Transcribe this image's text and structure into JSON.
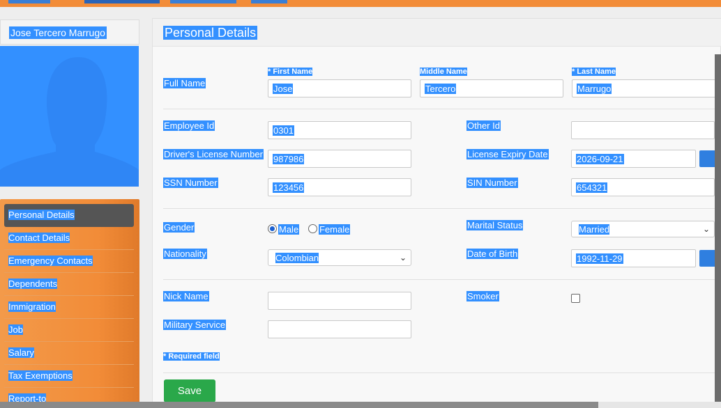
{
  "colors": {
    "accent": "#f28c38",
    "selection": "#3390ff",
    "save": "#2aa84a",
    "active_nav": "#555555"
  },
  "profile": {
    "name": "Jose Tercero Marrugo",
    "avatar_icon": "person-silhouette-icon"
  },
  "sidebar": {
    "items": [
      {
        "label": "Personal Details",
        "active": true
      },
      {
        "label": "Contact Details"
      },
      {
        "label": "Emergency Contacts"
      },
      {
        "label": "Dependents"
      },
      {
        "label": "Immigration"
      },
      {
        "label": "Job"
      },
      {
        "label": "Salary"
      },
      {
        "label": "Tax Exemptions"
      },
      {
        "label": "Report-to"
      }
    ]
  },
  "form": {
    "title": "Personal Details",
    "full_name": {
      "label": "Full Name",
      "first_label": "* First Name",
      "first_value": "Jose",
      "middle_label": "Middle Name",
      "middle_value": "Tercero",
      "last_label": "* Last Name",
      "last_value": "Marrugo"
    },
    "employee_id": {
      "label": "Employee Id",
      "value": "0301"
    },
    "other_id": {
      "label": "Other Id",
      "value": ""
    },
    "drivers_license": {
      "label": "Driver's License Number",
      "value": "987986"
    },
    "license_expiry": {
      "label": "License Expiry Date",
      "value": "2026-09-21"
    },
    "ssn": {
      "label": "SSN Number",
      "value": "123456"
    },
    "sin": {
      "label": "SIN Number",
      "value": "654321"
    },
    "gender": {
      "label": "Gender",
      "options": [
        "Male",
        "Female"
      ],
      "selected": "Male"
    },
    "marital_status": {
      "label": "Marital Status",
      "value": "Married"
    },
    "nationality": {
      "label": "Nationality",
      "value": "Colombian"
    },
    "dob": {
      "label": "Date of Birth",
      "value": "1992-11-29"
    },
    "nick_name": {
      "label": "Nick Name",
      "value": ""
    },
    "smoker": {
      "label": "Smoker",
      "checked": false
    },
    "military_service": {
      "label": "Military Service",
      "value": ""
    },
    "required_note": "* Required field",
    "save_label": "Save"
  }
}
